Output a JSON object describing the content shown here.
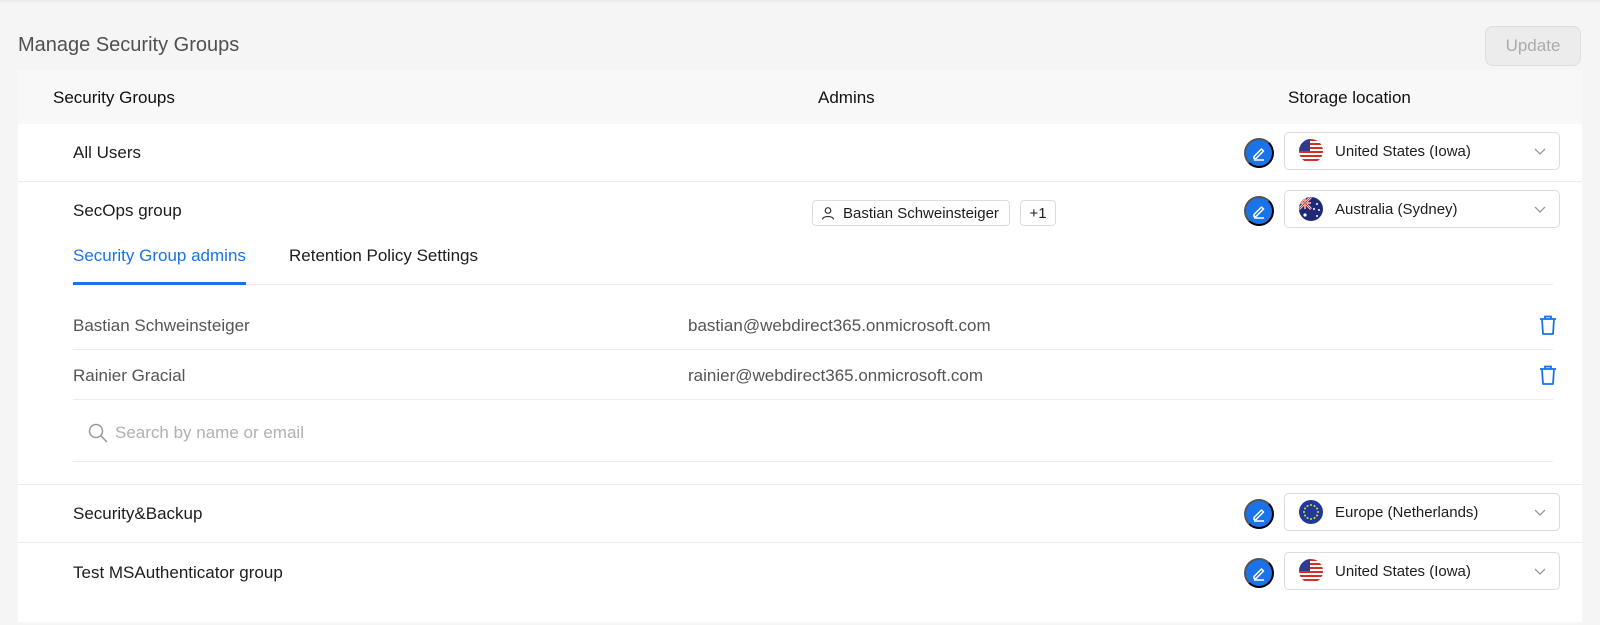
{
  "page": {
    "title": "Manage Security Groups",
    "update_label": "Update"
  },
  "table": {
    "headers": {
      "groups": "Security Groups",
      "admins": "Admins",
      "storage": "Storage location"
    },
    "rows": [
      {
        "name": "All Users",
        "location": "United States (Iowa)",
        "flag": "us-flag-icon"
      },
      {
        "name": "SecOps group",
        "location": "Australia (Sydney)",
        "flag": "au-flag-icon",
        "admin_chip": "Bastian Schweinsteiger",
        "admin_more": "+1"
      },
      {
        "name": "Security&Backup",
        "location": "Europe (Netherlands)",
        "flag": "eu-flag-icon"
      },
      {
        "name": "Test MSAuthenticator group",
        "location": "United States (Iowa)",
        "flag": "us-flag-icon"
      }
    ]
  },
  "expanded": {
    "tabs": [
      {
        "label": "Security Group admins",
        "active": true
      },
      {
        "label": "Retention Policy Settings",
        "active": false
      }
    ],
    "admins": [
      {
        "name": "Bastian Schweinsteiger",
        "email": "bastian@webdirect365.onmicrosoft.com"
      },
      {
        "name": "Rainier Gracial",
        "email": "rainier@webdirect365.onmicrosoft.com"
      }
    ],
    "search": {
      "placeholder": "Search by name or email",
      "value": ""
    }
  },
  "colors": {
    "accent": "#1a73e8",
    "background": "#f5f5f5"
  }
}
